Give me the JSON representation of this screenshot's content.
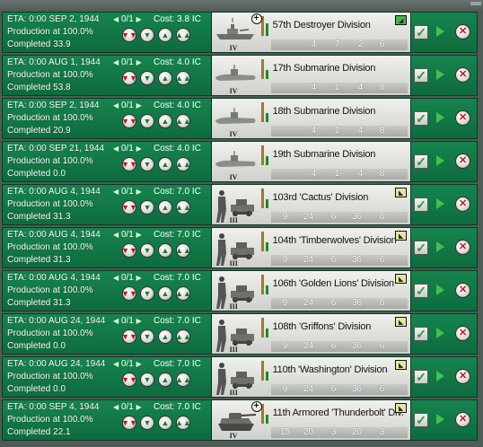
{
  "labels": {
    "eta_prefix": "ETA: 0:00",
    "cost_prefix": "Cost:",
    "cost_suffix": "IC",
    "production_line": "Production at 100.0%",
    "completed_prefix": "Completed"
  },
  "icons": {
    "queue_down_all": "double-down-arrow-icon",
    "queue_down": "down-arrow-icon",
    "queue_up": "up-arrow-icon",
    "queue_up_all": "double-up-arrow-icon",
    "confirm": "check-icon",
    "play": "play-icon",
    "cancel": "close-icon"
  },
  "colors": {
    "panel_green": "#16844f",
    "strength_bar": "#1d8a2a",
    "org_bar": "#a07a2a",
    "cancel_red": "#c21818"
  },
  "rows": [
    {
      "eta_date": "SEP 2, 1944",
      "quantity": "0/1",
      "cost": "3.8",
      "production": "Production at 100.0%",
      "completed": "33.9",
      "unit": "57th Destroyer Division",
      "rank": "IV",
      "kind": "ship",
      "stats": [
        "4",
        "7",
        "2",
        "6"
      ],
      "type_icon": "ship",
      "plus": true
    },
    {
      "eta_date": "AUG 1, 1944",
      "quantity": "0/1",
      "cost": "4.0",
      "production": "Production at 100.0%",
      "completed": "53.8",
      "unit": "17th Submarine Division",
      "rank": "IV",
      "kind": "sub",
      "stats": [
        "4",
        "1",
        "4",
        "8"
      ],
      "type_icon": "",
      "plus": false
    },
    {
      "eta_date": "SEP 2, 1944",
      "quantity": "0/1",
      "cost": "4.0",
      "production": "Production at 100.0%",
      "completed": "20.9",
      "unit": "18th Submarine Division",
      "rank": "IV",
      "kind": "sub",
      "stats": [
        "4",
        "1",
        "4",
        "8"
      ],
      "type_icon": "",
      "plus": false
    },
    {
      "eta_date": "SEP 21, 1944",
      "quantity": "0/1",
      "cost": "4.0",
      "production": "Production at 100.0%",
      "completed": "0.0",
      "unit": "19th Submarine Division",
      "rank": "IV",
      "kind": "sub",
      "stats": [
        "4",
        "1",
        "4",
        "8"
      ],
      "type_icon": "",
      "plus": false
    },
    {
      "eta_date": "AUG 4, 1944",
      "quantity": "0/1",
      "cost": "7.0",
      "production": "Production at 100.0%",
      "completed": "31.3",
      "unit": "103rd 'Cactus' Division",
      "rank": "III",
      "kind": "army",
      "stats": [
        "9",
        "24",
        "6",
        "36",
        "6"
      ],
      "type_icon": "armor",
      "plus": false
    },
    {
      "eta_date": "AUG 4, 1944",
      "quantity": "0/1",
      "cost": "7.0",
      "production": "Production at 100.0%",
      "completed": "31.3",
      "unit": "104th 'Timberwolves' Division",
      "rank": "III",
      "kind": "army",
      "stats": [
        "9",
        "24",
        "6",
        "36",
        "6"
      ],
      "type_icon": "armor",
      "plus": false
    },
    {
      "eta_date": "AUG 4, 1944",
      "quantity": "0/1",
      "cost": "7.0",
      "production": "Production at 100.0%",
      "completed": "31.3",
      "unit": "106th 'Golden Lions' Division",
      "rank": "III",
      "kind": "army",
      "stats": [
        "9",
        "24",
        "6",
        "36",
        "6"
      ],
      "type_icon": "armor",
      "plus": false
    },
    {
      "eta_date": "AUG 24, 1944",
      "quantity": "0/1",
      "cost": "7.0",
      "production": "Production at 100.0%",
      "completed": "0.0",
      "unit": "108th 'Griffons' Division",
      "rank": "III",
      "kind": "army",
      "stats": [
        "9",
        "24",
        "6",
        "36",
        "6"
      ],
      "type_icon": "armor",
      "plus": false
    },
    {
      "eta_date": "AUG 24, 1944",
      "quantity": "0/1",
      "cost": "7.0",
      "production": "Production at 100.0%",
      "completed": "0.0",
      "unit": "110th 'Washington' Division",
      "rank": "III",
      "kind": "army",
      "stats": [
        "9",
        "24",
        "6",
        "36",
        "6"
      ],
      "type_icon": "armor",
      "plus": false
    },
    {
      "eta_date": "SEP 4, 1944",
      "quantity": "0/1",
      "cost": "7.0",
      "production": "Production at 100.0%",
      "completed": "22.1",
      "unit": "11th Armored 'Thunderbolt' Div.",
      "rank": "IV",
      "kind": "tank",
      "stats": [
        "15",
        "20",
        "3",
        "20",
        "3"
      ],
      "type_icon": "armor",
      "plus": true
    }
  ]
}
